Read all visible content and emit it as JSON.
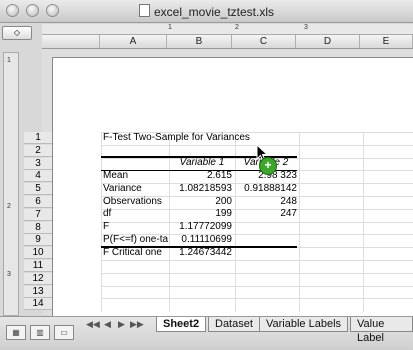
{
  "window": {
    "title": "excel_movie_tztest.xls"
  },
  "columns": [
    "A",
    "B",
    "C",
    "D",
    "E"
  ],
  "ruler": [
    "1",
    "2",
    "3"
  ],
  "vruler": [
    "1",
    "2",
    "3"
  ],
  "rows": [
    "1",
    "2",
    "3",
    "4",
    "5",
    "6",
    "7",
    "8",
    "9",
    "10",
    "11",
    "12",
    "13",
    "14"
  ],
  "sheet": {
    "title": "F-Test Two-Sample for Variances",
    "header": [
      "Variable 1",
      "Variable 2"
    ],
    "data": [
      {
        "label": "Mean",
        "v1": "2.615",
        "v2": "2.98 323"
      },
      {
        "label": "Variance",
        "v1": "1.08218593",
        "v2": "0.91888142"
      },
      {
        "label": "Observations",
        "v1": "200",
        "v2": "248"
      },
      {
        "label": "df",
        "v1": "199",
        "v2": "247"
      },
      {
        "label": "F",
        "v1": "1.17772099",
        "v2": ""
      },
      {
        "label": "P(F<=f) one-ta",
        "v1": "0.11110699",
        "v2": ""
      },
      {
        "label": "F Critical one",
        "v1": "1.24673442",
        "v2": ""
      }
    ]
  },
  "tabs": [
    "Sheet2",
    "Dataset",
    "Variable Labels",
    "Value Label"
  ],
  "active_tab": "Sheet2",
  "nav": [
    "◀◀",
    "◀",
    "▶",
    "▶▶"
  ]
}
